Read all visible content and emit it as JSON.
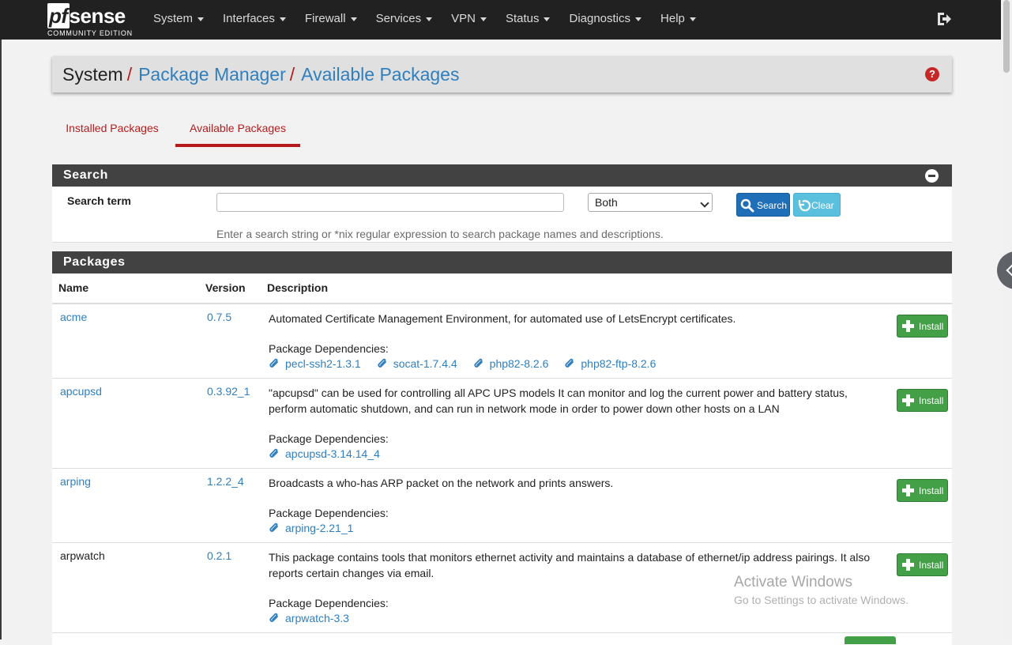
{
  "brand": {
    "main_pf": "pf",
    "main_rest": "sense",
    "subtitle": "COMMUNITY EDITION"
  },
  "menu": [
    "System",
    "Interfaces",
    "Firewall",
    "Services",
    "VPN",
    "Status",
    "Diagnostics",
    "Help"
  ],
  "breadcrumb": {
    "root": "System",
    "level1": "Package Manager",
    "level2": "Available Packages",
    "separator": "/"
  },
  "tabs": {
    "installed": "Installed Packages",
    "available": "Available Packages",
    "active": "Available Packages"
  },
  "search_panel": {
    "title": "Search",
    "label": "Search term",
    "input_value": "",
    "scope_selected": "Both",
    "search_button": "Search",
    "clear_button": "Clear",
    "help": "Enter a search string or *nix regular expression to search package names and descriptions."
  },
  "packages_panel": {
    "title": "Packages",
    "columns": {
      "name": "Name",
      "version": "Version",
      "description": "Description"
    },
    "dep_label": "Package Dependencies:",
    "install_label": "Install",
    "rows": [
      {
        "name": "acme",
        "version": "0.7.5",
        "description": "Automated Certificate Management Environment, for automated use of LetsEncrypt certificates.",
        "deps": [
          "pecl-ssh2-1.3.1",
          "socat-1.7.4.4",
          "php82-8.2.6",
          "php82-ftp-8.2.6"
        ]
      },
      {
        "name": "apcupsd",
        "version": "0.3.92_1",
        "description": "\"apcupsd\" can be used for controlling all APC UPS models It can monitor and log the current power and battery status, perform automatic shutdown, and can run in network mode in order to power down other hosts on a LAN",
        "deps": [
          "apcupsd-3.14.14_4"
        ]
      },
      {
        "name": "arping",
        "version": "1.2.2_4",
        "description": "Broadcasts a who-has ARP packet on the network and prints answers.",
        "deps": [
          "arping-2.21_1"
        ]
      },
      {
        "name": "arpwatch",
        "version": "0.2.1",
        "description": "This package contains tools that monitors ethernet activity and maintains a database of ethernet/ip address pairings. It also reports certain changes via email.",
        "deps": [
          "arpwatch-3.3"
        ]
      }
    ]
  },
  "watermark": {
    "title": "Activate Windows",
    "subtitle": "Go to Settings to activate Windows."
  },
  "icons": {
    "logout": "sign-out-icon",
    "help": "question-circle-icon",
    "collapse": "minus-circle-icon",
    "search": "magnifier-icon",
    "clear": "undo-icon",
    "dependency": "paperclip-icon",
    "install": "plus-icon"
  },
  "colors": {
    "navbar": "#212121",
    "accent_red": "#b71c1c",
    "link_blue": "#2f7fbf",
    "install_green": "#43a047",
    "search_blue": "#1f6fb8",
    "clear_cyan": "#5bc0de",
    "panel_header": "#424242"
  }
}
